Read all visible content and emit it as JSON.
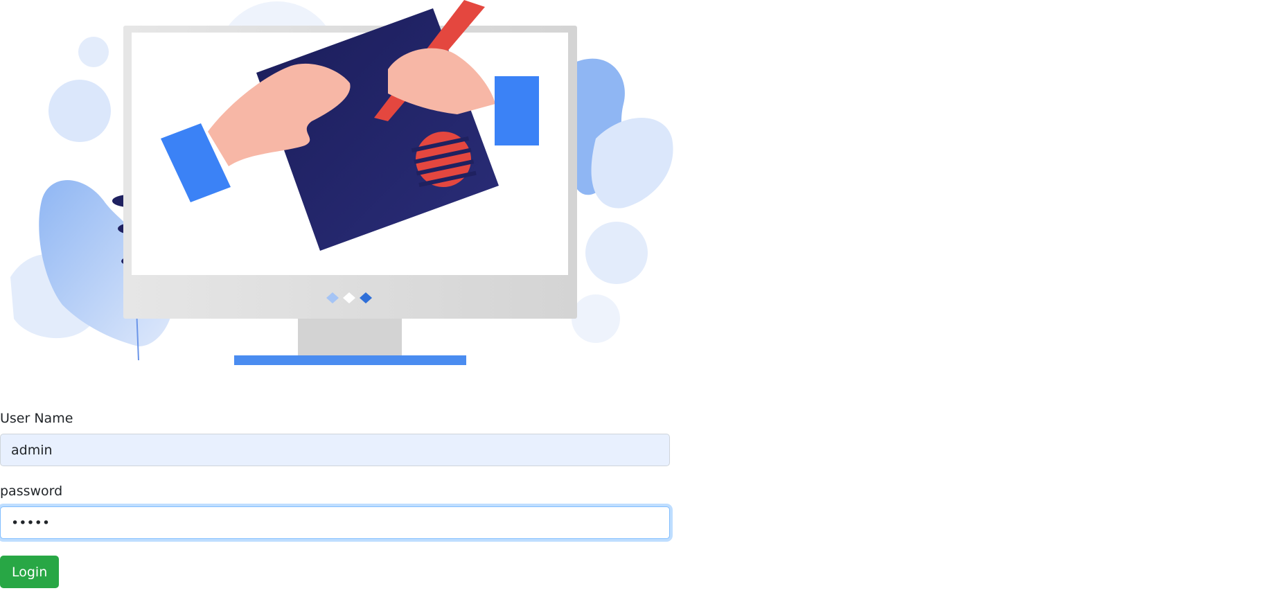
{
  "illustration": {
    "name": "computer-illustration",
    "colors": {
      "navy": "#1f2160",
      "blue": "#3b82f6",
      "light_blue": "#a5c4f5",
      "pale_blue": "#dbe7fb",
      "red": "#e4473f",
      "skin": "#f7b7a6",
      "monitor_gray": "#dedede"
    }
  },
  "form": {
    "username_label": "User Name",
    "username_value": "admin",
    "password_label": "password",
    "password_value": "*****",
    "login_label": "Login"
  },
  "colors": {
    "accent_success": "#28a745",
    "input_autofill": "#e8f0fe",
    "focus_ring": "#80bdff"
  }
}
